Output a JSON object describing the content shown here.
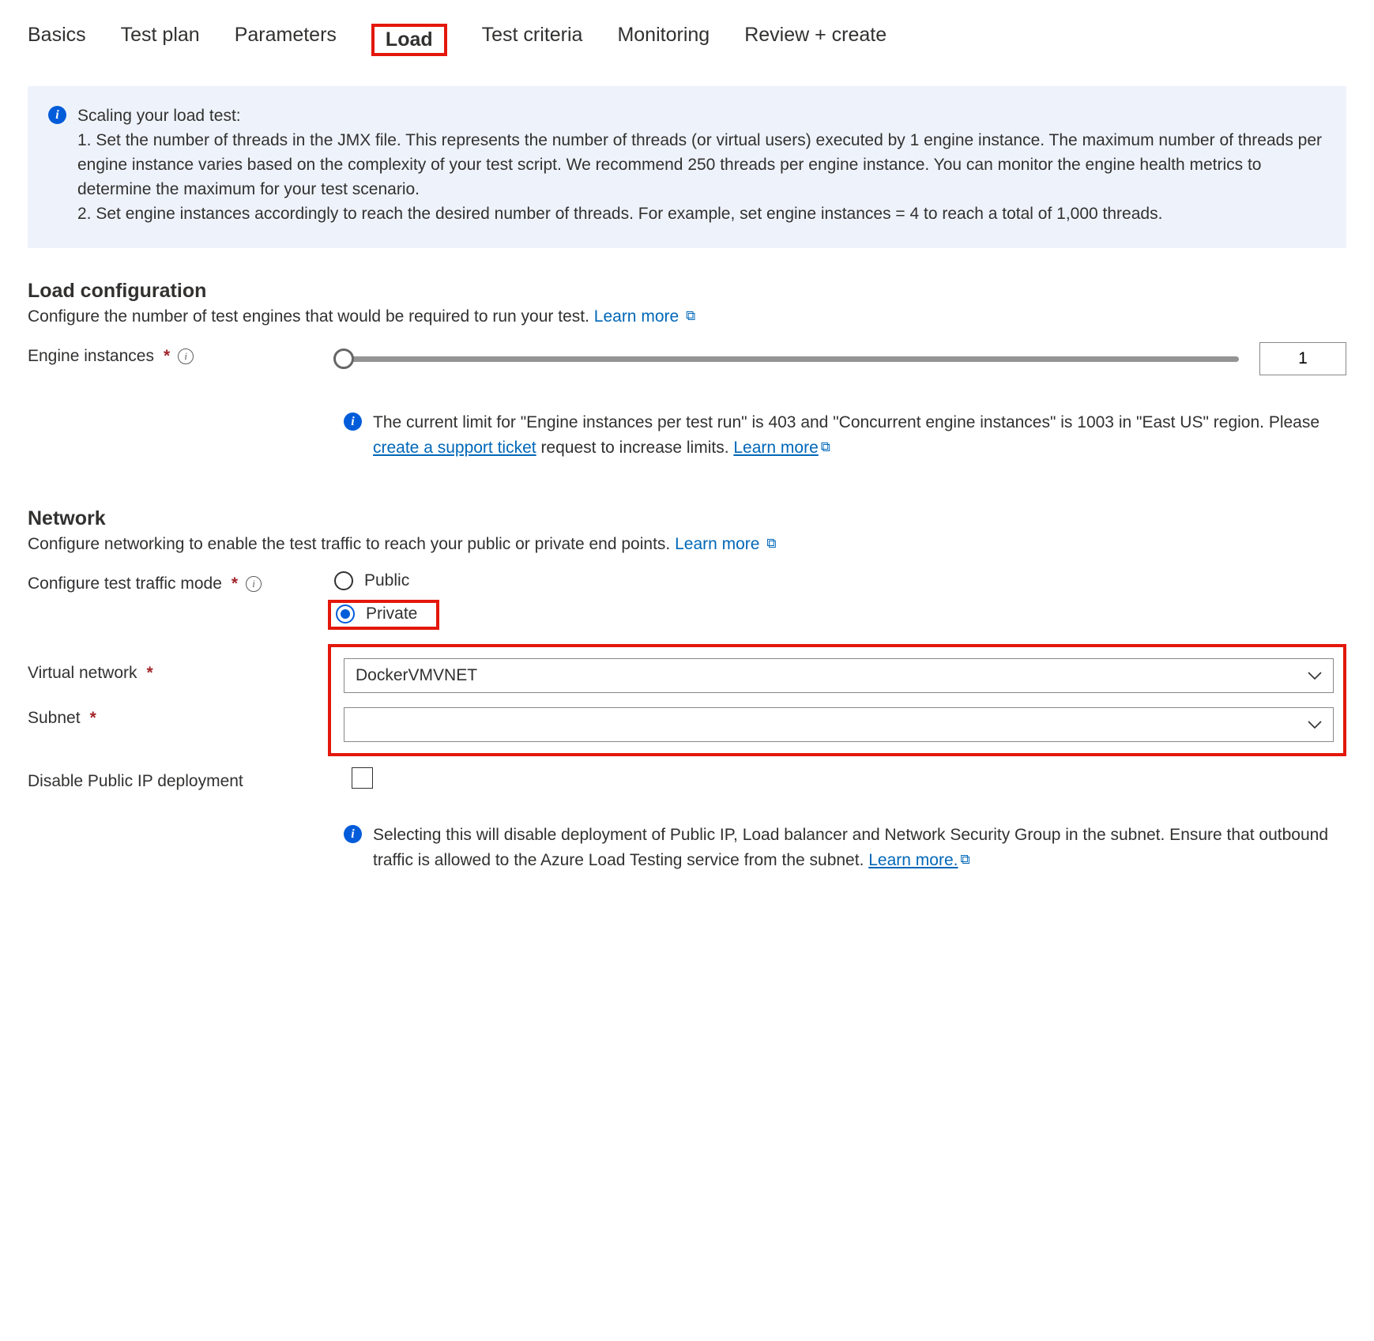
{
  "tabs": {
    "basics": "Basics",
    "testplan": "Test plan",
    "parameters": "Parameters",
    "load": "Load",
    "criteria": "Test criteria",
    "monitoring": "Monitoring",
    "review": "Review + create"
  },
  "info": {
    "title": "Scaling your load test:",
    "line1": "1. Set the number of threads in the JMX file. This represents the number of threads (or virtual users) executed by 1 engine instance. The maximum number of threads per engine instance varies based on the complexity of your test script. We recommend 250 threads per engine instance. You can monitor the engine health metrics to determine the maximum for your test scenario.",
    "line2": "2. Set engine instances accordingly to reach the desired number of threads. For example, set engine instances = 4 to reach a total of 1,000 threads."
  },
  "loadConfig": {
    "heading": "Load configuration",
    "desc": "Configure the number of test engines that would be required to run your test.",
    "learnMore": "Learn more",
    "engineLabel": "Engine instances",
    "engineValue": "1",
    "limits_a": "The current limit for \"Engine instances per test run\" is 403 and \"Concurrent engine instances\" is 1003 in \"East US\" region. Please ",
    "limits_link1": "create a support ticket",
    "limits_b": " request to increase limits. ",
    "limits_link2": "Learn more"
  },
  "network": {
    "heading": "Network",
    "desc": "Configure networking to enable the test traffic to reach your public or private end points.",
    "learnMore": "Learn more",
    "trafficLabel": "Configure test traffic mode",
    "public": "Public",
    "private": "Private",
    "vnetLabel": "Virtual network",
    "vnetValue": "DockerVMVNET",
    "subnetLabel": "Subnet",
    "subnetValue": "",
    "disableLabel": "Disable Public IP deployment",
    "disableInfo_a": "Selecting this will disable deployment of Public IP, Load balancer and Network Security Group in the subnet. Ensure that outbound traffic is allowed to the Azure Load Testing service from the subnet. ",
    "disableInfo_link": "Learn more."
  }
}
